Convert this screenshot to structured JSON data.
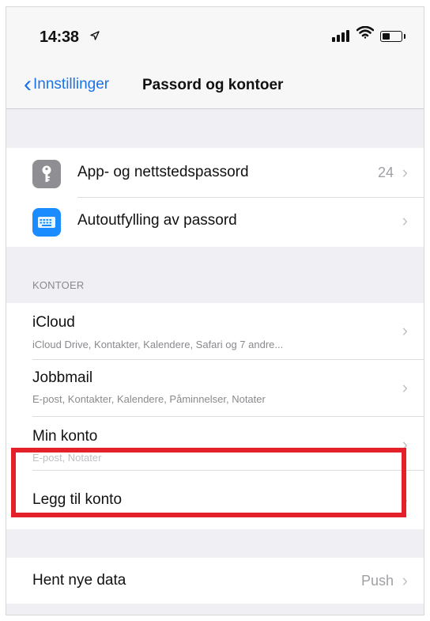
{
  "status": {
    "time": "14:38",
    "location_icon": "location-arrow-icon",
    "signal_icon": "signal-bars-icon",
    "wifi_icon": "wifi-icon",
    "battery_icon": "battery-icon"
  },
  "nav": {
    "back_label": "Innstillinger",
    "title": "Passord og kontoer",
    "accent": "#1a73e8"
  },
  "passwords": {
    "items": [
      {
        "label": "App- og nettstedspassord",
        "value": "24",
        "icon": "key-icon"
      },
      {
        "label": "Autoutfylling av passord",
        "value": "",
        "icon": "keyboard-icon"
      }
    ]
  },
  "accounts": {
    "header": "KONTOER",
    "items": [
      {
        "label": "iCloud",
        "detail": "iCloud Drive, Kontakter, Kalendere, Safari og 7 andre..."
      },
      {
        "label": "Jobbmail",
        "detail": "E-post, Kontakter, Kalendere, Påminnelser, Notater"
      },
      {
        "label": "Min konto",
        "detail": "E-post, Notater"
      },
      {
        "label": "Legg til konto",
        "detail": ""
      }
    ]
  },
  "fetch": {
    "label": "Hent nye data",
    "value": "Push"
  },
  "highlight_color": "#e4202a"
}
